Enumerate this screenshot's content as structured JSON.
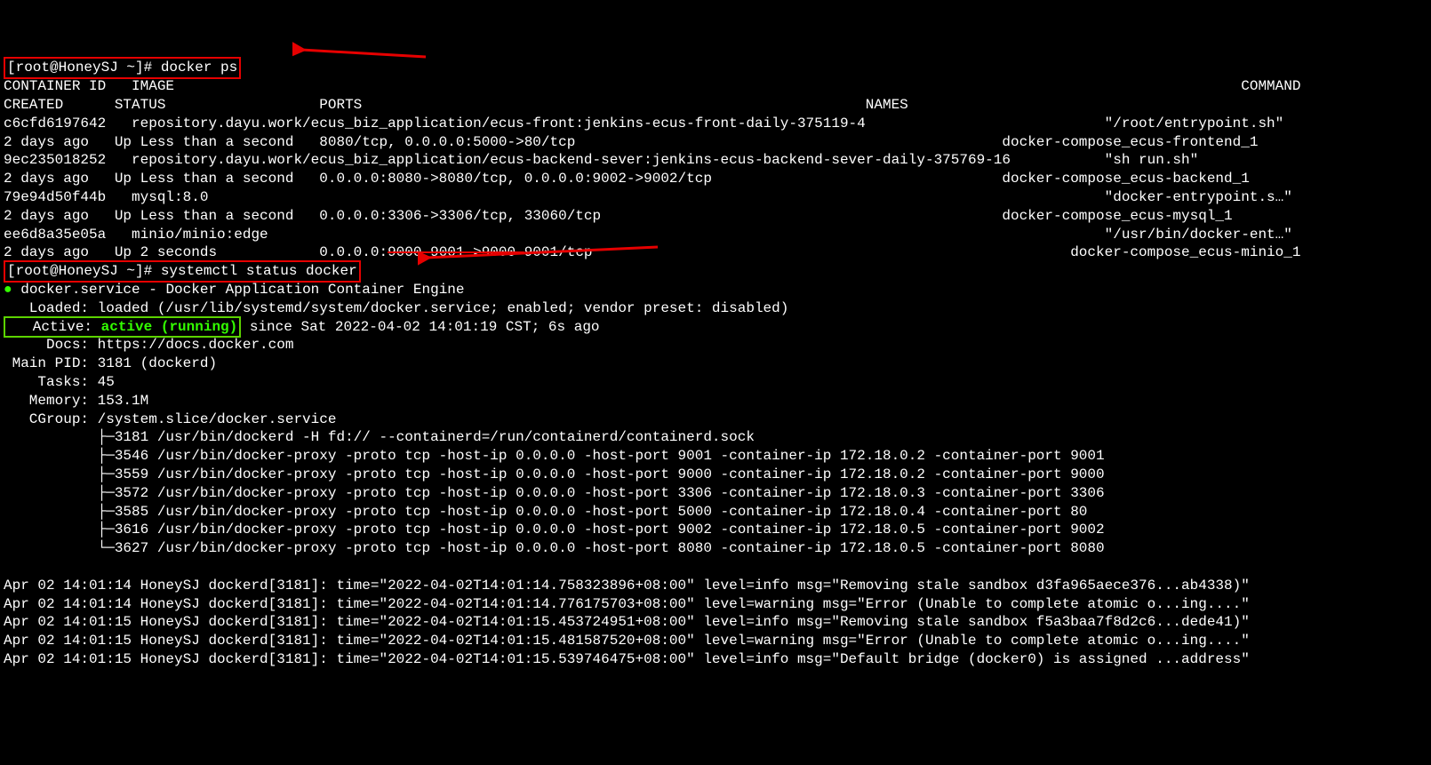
{
  "prompt1": "[root@HoneySJ ~]# docker ps",
  "header": {
    "c1": "CONTAINER ID   IMAGE",
    "c2": "COMMAND",
    "c3": "CREATED      STATUS                  PORTS",
    "c4": "NAMES"
  },
  "rows": [
    {
      "a": "c6cfd6197642   repository.dayu.work/ecus_biz_application/ecus-front:jenkins-ecus-front-daily-375119-4",
      "b": "\"/root/entrypoint.sh\"",
      "c": "2 days ago   Up Less than a second   8080/tcp, 0.0.0.0:5000->80/tcp",
      "d": "docker-compose_ecus-frontend_1"
    },
    {
      "a": "9ec235018252   repository.dayu.work/ecus_biz_application/ecus-backend-sever:jenkins-ecus-backend-sever-daily-375769-16",
      "b": "\"sh run.sh\"",
      "c": "2 days ago   Up Less than a second   0.0.0.0:8080->8080/tcp, 0.0.0.0:9002->9002/tcp",
      "d": "docker-compose_ecus-backend_1"
    },
    {
      "a": "79e94d50f44b   mysql:8.0",
      "b": "\"docker-entrypoint.s…\"",
      "c": "2 days ago   Up Less than a second   0.0.0.0:3306->3306/tcp, 33060/tcp",
      "d": "docker-compose_ecus-mysql_1"
    },
    {
      "a": "ee6d8a35e05a   minio/minio:edge",
      "b": "\"/usr/bin/docker-ent…\"",
      "c_pre": "2 days ago   Up 2 seconds            0.0.0.0:",
      "c_strike": "9000-9001->9000-",
      "c_post": "9001/tcp",
      "d": "docker-compose_ecus-minio_1"
    }
  ],
  "prompt2": "[root@HoneySJ ~]# systemctl status docker",
  "status": {
    "line1": " docker.service - Docker Application Container Engine",
    "loaded": "   Loaded: loaded (/usr/lib/systemd/system/docker.service; enabled; vendor preset: disabled)",
    "active_label": "   Active: ",
    "active_state": "active (running)",
    "active_rest": " since Sat 2022-04-02 14:01:19 CST; 6s ago",
    "docs": "     Docs: https://docs.docker.com",
    "mainpid": " Main PID: 3181 (dockerd)",
    "tasks": "    Tasks: 45",
    "memory": "   Memory: 153.1M",
    "cgroup": "   CGroup: /system.slice/docker.service",
    "procs": [
      "           ├─3181 /usr/bin/dockerd -H fd:// --containerd=/run/containerd/containerd.sock",
      "           ├─3546 /usr/bin/docker-proxy -proto tcp -host-ip 0.0.0.0 -host-port 9001 -container-ip 172.18.0.2 -container-port 9001",
      "           ├─3559 /usr/bin/docker-proxy -proto tcp -host-ip 0.0.0.0 -host-port 9000 -container-ip 172.18.0.2 -container-port 9000",
      "           ├─3572 /usr/bin/docker-proxy -proto tcp -host-ip 0.0.0.0 -host-port 3306 -container-ip 172.18.0.3 -container-port 3306",
      "           ├─3585 /usr/bin/docker-proxy -proto tcp -host-ip 0.0.0.0 -host-port 5000 -container-ip 172.18.0.4 -container-port 80",
      "           ├─3616 /usr/bin/docker-proxy -proto tcp -host-ip 0.0.0.0 -host-port 9002 -container-ip 172.18.0.5 -container-port 9002",
      "           └─3627 /usr/bin/docker-proxy -proto tcp -host-ip 0.0.0.0 -host-port 8080 -container-ip 172.18.0.5 -container-port 8080"
    ],
    "blank": "",
    "log": [
      "Apr 02 14:01:14 HoneySJ dockerd[3181]: time=\"2022-04-02T14:01:14.758323896+08:00\" level=info msg=\"Removing stale sandbox d3fa965aece376...ab4338)\"",
      "Apr 02 14:01:14 HoneySJ dockerd[3181]: time=\"2022-04-02T14:01:14.776175703+08:00\" level=warning msg=\"Error (Unable to complete atomic o...ing....\"",
      "Apr 02 14:01:15 HoneySJ dockerd[3181]: time=\"2022-04-02T14:01:15.453724951+08:00\" level=info msg=\"Removing stale sandbox f5a3baa7f8d2c6...dede41)\"",
      "Apr 02 14:01:15 HoneySJ dockerd[3181]: time=\"2022-04-02T14:01:15.481587520+08:00\" level=warning msg=\"Error (Unable to complete atomic o...ing....\"",
      "Apr 02 14:01:15 HoneySJ dockerd[3181]: time=\"2022-04-02T14:01:15.539746475+08:00\" level=info msg=\"Default bridge (docker0) is assigned ...address\""
    ]
  }
}
